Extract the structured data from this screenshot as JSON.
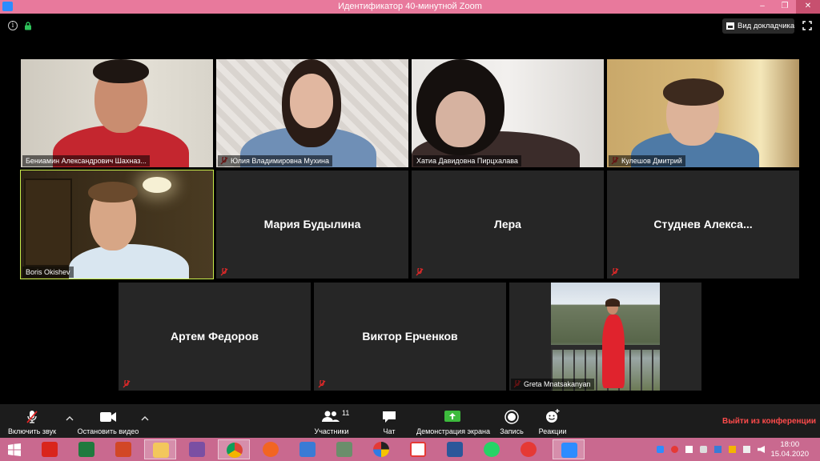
{
  "window": {
    "title": "Идентификатор 40-минутной Zoom",
    "controls": [
      "–",
      "❐",
      "✕"
    ]
  },
  "topbar": {
    "speaker_view_label": "Вид докладчика"
  },
  "participants": [
    {
      "name": "Бениамин Александрович Шахназ...",
      "video": true,
      "muted": false
    },
    {
      "name": "Юлия Владимировна Мухина",
      "video": true,
      "muted": true
    },
    {
      "name": "Хатиа Давидовна Пирцхалава",
      "video": true,
      "muted": false
    },
    {
      "name": "Кулешов Дмитрий",
      "video": true,
      "muted": true
    },
    {
      "name": "Boris Okishev",
      "video": true,
      "muted": false,
      "active_speaker": true
    },
    {
      "name": "Мария Будылина",
      "video": false,
      "muted": true
    },
    {
      "name": "Лера",
      "video": false,
      "muted": true
    },
    {
      "name": "Студнев Алекса...",
      "video": false,
      "muted": true
    },
    {
      "name": "Артем Федоров",
      "video": false,
      "muted": true
    },
    {
      "name": "Виктор Ерченков",
      "video": false,
      "muted": true
    },
    {
      "name": "Greta Mnatsakanyan",
      "video": true,
      "muted": true
    }
  ],
  "toolbar": {
    "unmute_label": "Включить звук",
    "start_video_label": "Остановить видео",
    "participants_label": "Участники",
    "participants_count": "11",
    "chat_label": "Чат",
    "share_label": "Демонстрация экрана",
    "record_label": "Запись",
    "reactions_label": "Реакции",
    "leave_label": "Выйти из конференции"
  },
  "taskbar": {
    "time": "18:00",
    "date": "15.04.2020"
  },
  "colors": {
    "titlebar": "#e8799c",
    "taskbar": "#c9698f",
    "active_speaker": "#c8ed4b",
    "leave": "#ff4b4b",
    "share_green": "#3dbb3d"
  }
}
